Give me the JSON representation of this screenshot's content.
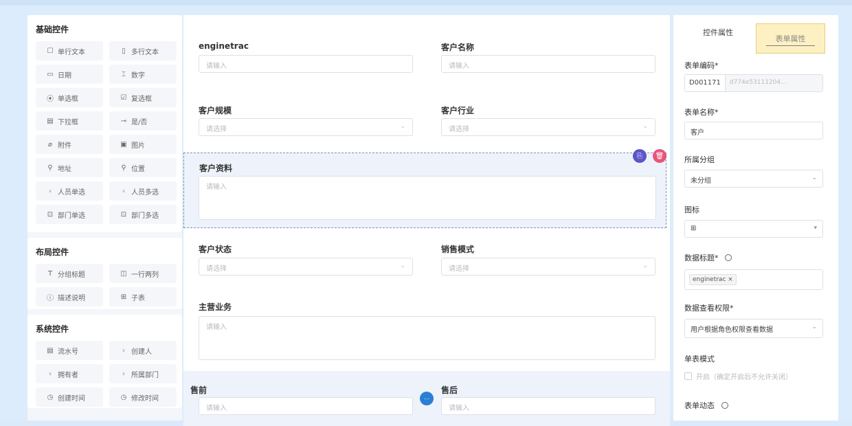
{
  "palette": {
    "basic": {
      "title": "基础控件",
      "items": [
        {
          "icon": "☐",
          "label": "单行文本"
        },
        {
          "icon": "▯",
          "label": "多行文本"
        },
        {
          "icon": "▭",
          "label": "日期"
        },
        {
          "icon": "⌶",
          "label": "数字"
        },
        {
          "icon": "⦿",
          "label": "单选框"
        },
        {
          "icon": "☑",
          "label": "复选框"
        },
        {
          "icon": "▤",
          "label": "下拉框"
        },
        {
          "icon": "⊸",
          "label": "是/否"
        },
        {
          "icon": "⌀",
          "label": "附件"
        },
        {
          "icon": "▣",
          "label": "图片"
        },
        {
          "icon": "⚲",
          "label": "地址"
        },
        {
          "icon": "⚲",
          "label": "位置"
        },
        {
          "icon": "⍤",
          "label": "人员单选"
        },
        {
          "icon": "⍤",
          "label": "人员多选"
        },
        {
          "icon": "⊡",
          "label": "部门单选"
        },
        {
          "icon": "⊡",
          "label": "部门多选"
        }
      ]
    },
    "layout": {
      "title": "布局控件",
      "items": [
        {
          "icon": "T",
          "label": "分组标题"
        },
        {
          "icon": "◫",
          "label": "一行两列"
        },
        {
          "icon": "ⓘ",
          "label": "描述说明"
        },
        {
          "icon": "⊞",
          "label": "子表"
        }
      ]
    },
    "system": {
      "title": "系统控件",
      "items": [
        {
          "icon": "▤",
          "label": "流水号"
        },
        {
          "icon": "⍤",
          "label": "创建人"
        },
        {
          "icon": "⍤",
          "label": "拥有者"
        },
        {
          "icon": "⍤",
          "label": "所属部门"
        },
        {
          "icon": "◷",
          "label": "创建时间"
        },
        {
          "icon": "◷",
          "label": "修改时间"
        }
      ]
    }
  },
  "canvas": {
    "f_enginetrac": {
      "label": "enginetrac",
      "placeholder": "请输入"
    },
    "f_name": {
      "label": "客户名称",
      "placeholder": "请输入"
    },
    "f_scale": {
      "label": "客户规模",
      "placeholder": "请选择"
    },
    "f_industry": {
      "label": "客户行业",
      "placeholder": "请选择"
    },
    "f_profile": {
      "label": "客户资料",
      "placeholder": "请输入"
    },
    "f_status": {
      "label": "客户状态",
      "placeholder": "请选择"
    },
    "f_sales": {
      "label": "销售模式",
      "placeholder": "请选择"
    },
    "f_business": {
      "label": "主营业务",
      "placeholder": "请输入"
    },
    "f_presale": {
      "label": "售前",
      "placeholder": "请输入"
    },
    "f_aftersale": {
      "label": "售后",
      "placeholder": "请输入"
    }
  },
  "panel": {
    "tab_control": "控件属性",
    "tab_form": "表单属性",
    "code_label": "表单编码*",
    "code_prefix": "D001171",
    "code_value": "d774e53111204...",
    "name_label": "表单名称*",
    "name_value": "客户",
    "group_label": "所属分组",
    "group_value": "未分组",
    "icon_label": "图标",
    "icon_value": "⊞",
    "title_label": "数据标题*",
    "title_tag": "enginetrac",
    "perm_label": "数据查看权限*",
    "perm_value": "用户根据角色权限查看数据",
    "mode_label": "单表模式",
    "mode_checkbox": "开启（确定开启后不允许关闭）",
    "dynamic_label": "表单动态"
  }
}
